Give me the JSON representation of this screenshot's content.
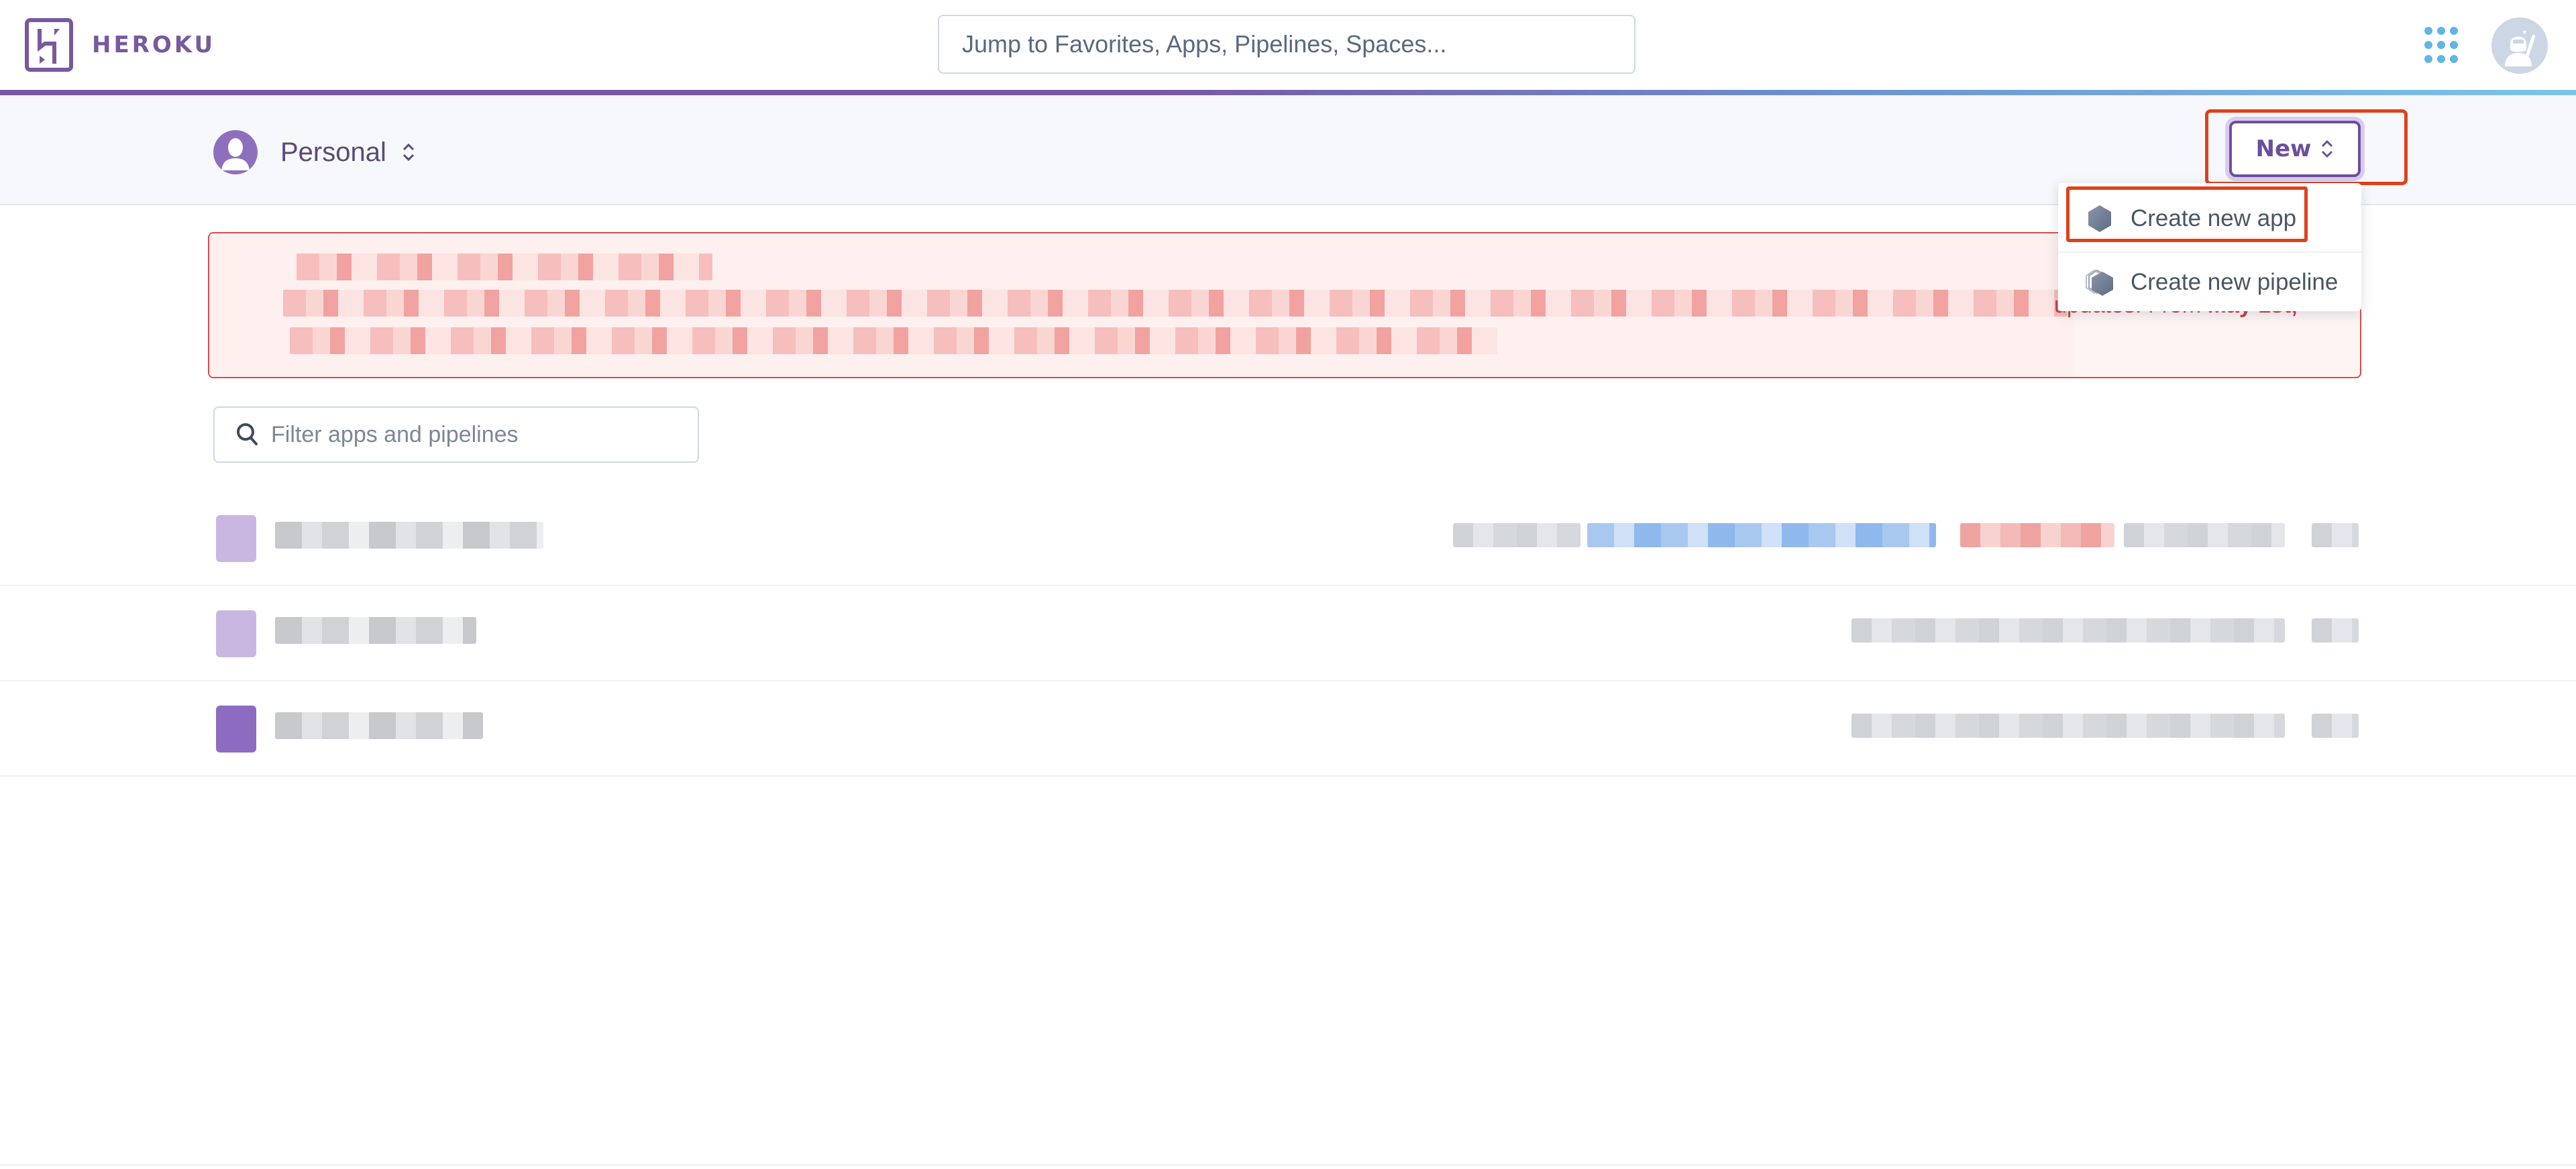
{
  "topnav": {
    "brand": "HEROKU",
    "brand_icon": "heroku-logo-icon",
    "search_placeholder": "Jump to Favorites, Apps, Pipelines, Spaces...",
    "apps_icon": "apps-grid-icon",
    "avatar_icon": "ninja-avatar-icon",
    "bar_colors": [
      "#79589f",
      "#7ec5e8"
    ]
  },
  "subheader": {
    "account_label": "Personal",
    "account_icon": "user-silhouette-icon",
    "new_button_label": "New",
    "new_button_icon": "chevron-up-down-icon"
  },
  "dropdown": {
    "items": [
      {
        "label": "Create new app",
        "icon": "hexagon-icon",
        "highlighted": true
      },
      {
        "label": "Create new pipeline",
        "icon": "stacked-hexagons-icon",
        "highlighted": false
      }
    ]
  },
  "banner": {
    "visible_fragment_prefix": "updates. From ",
    "visible_fragment_bold": "May 1st,",
    "redacted": true,
    "color": "#d94c4c"
  },
  "filter": {
    "placeholder": "Filter apps and pipelines",
    "icon": "search-icon"
  },
  "apps": {
    "rows": [
      {
        "redacted": true
      },
      {
        "redacted": true
      },
      {
        "redacted": true
      }
    ]
  },
  "colors": {
    "brand": "#79589f",
    "highlight_annotation": "#e0401c",
    "accent_blue": "#62b4e4"
  }
}
